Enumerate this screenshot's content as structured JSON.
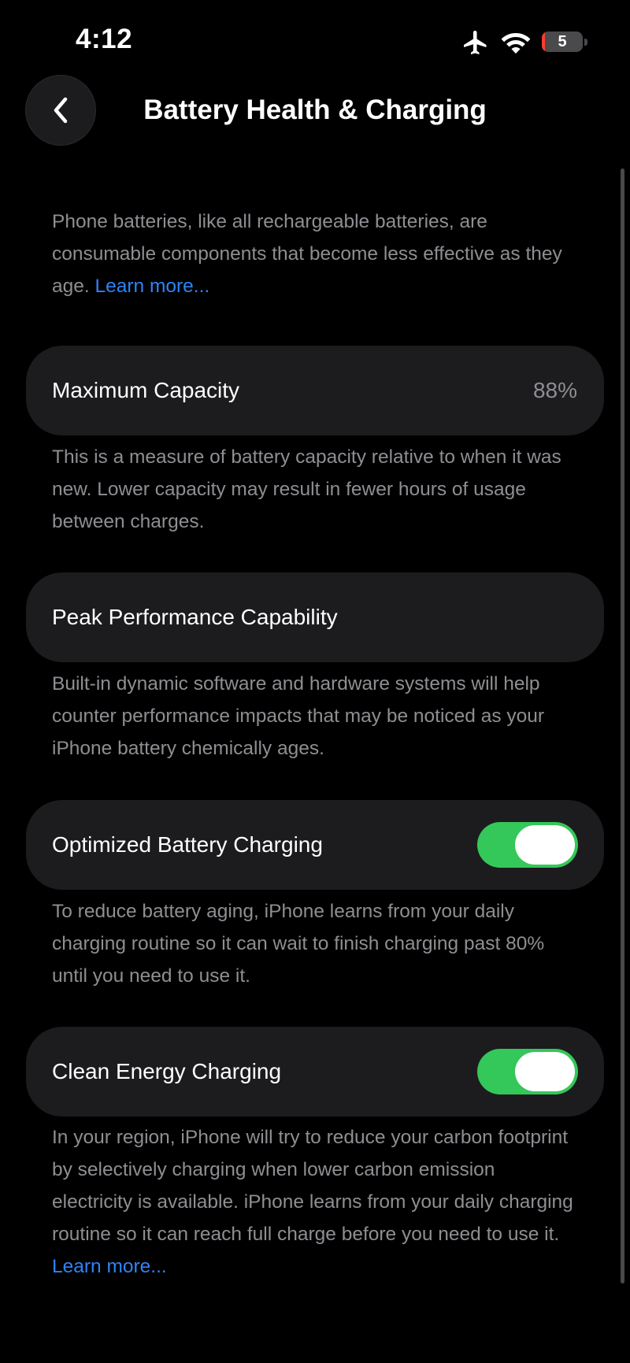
{
  "status_bar": {
    "time": "4:12",
    "airplane_icon": "airplane-icon",
    "wifi_icon": "wifi-icon",
    "battery": {
      "level_text": "5",
      "level_percent": 5,
      "fill_color": "#ff3b30"
    }
  },
  "nav": {
    "back_icon": "chevron-left-icon",
    "title": "Battery Health & Charging"
  },
  "intro": {
    "text": "Phone batteries, like all rechargeable batteries, are consumable components that become less effective as they age. ",
    "link": "Learn more..."
  },
  "max_capacity": {
    "label": "Maximum Capacity",
    "value": "88%",
    "description": "This is a measure of battery capacity relative to when it was new. Lower capacity may result in fewer hours of usage between charges."
  },
  "peak_performance": {
    "label": "Peak Performance Capability",
    "description": "Built-in dynamic software and hardware systems will help counter performance impacts that may be noticed as your iPhone battery chemically ages."
  },
  "optimized_charging": {
    "label": "Optimized Battery Charging",
    "enabled": true,
    "description": "To reduce battery aging, iPhone learns from your daily charging routine so it can wait to finish charging past 80% until you need to use it."
  },
  "clean_energy": {
    "label": "Clean Energy Charging",
    "enabled": true,
    "description": "In your region, iPhone will try to reduce your carbon footprint by selectively charging when lower carbon emission electricity is available. iPhone learns from your daily charging routine so it can reach full charge before you need to use it. ",
    "link": "Learn more..."
  },
  "colors": {
    "background": "#000000",
    "card": "#1c1c1e",
    "secondary_text": "#8e8e93",
    "link": "#2f83f6",
    "toggle_on": "#34c759"
  }
}
